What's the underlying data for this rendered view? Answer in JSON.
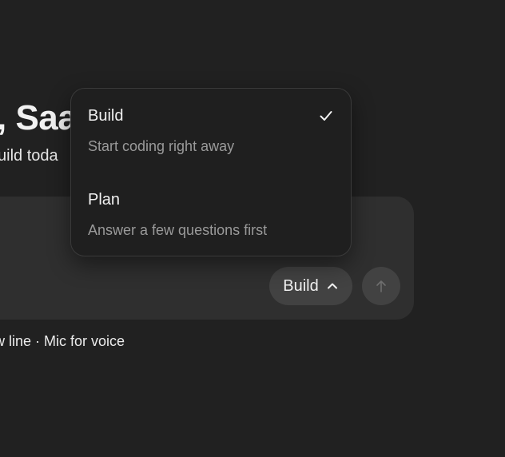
{
  "greeting": {
    "title": ", Saa",
    "subtitle": "uild toda"
  },
  "composer": {
    "mode_button_label": "Build",
    "hint": "w line · Mic for voice"
  },
  "mode_menu": {
    "options": [
      {
        "title": "Build",
        "description": "Start coding right away",
        "selected": true
      },
      {
        "title": "Plan",
        "description": "Answer a few questions first",
        "selected": false
      }
    ]
  },
  "icons": {
    "mode_chevron": "chevron-up-icon",
    "send": "arrow-up-icon",
    "selected_check": "check-icon"
  },
  "colors": {
    "background": "#212121",
    "composer": "#2f2f2f",
    "button": "#424242",
    "menu": "#1f1f1f",
    "muted_text": "#9a9a9a"
  }
}
